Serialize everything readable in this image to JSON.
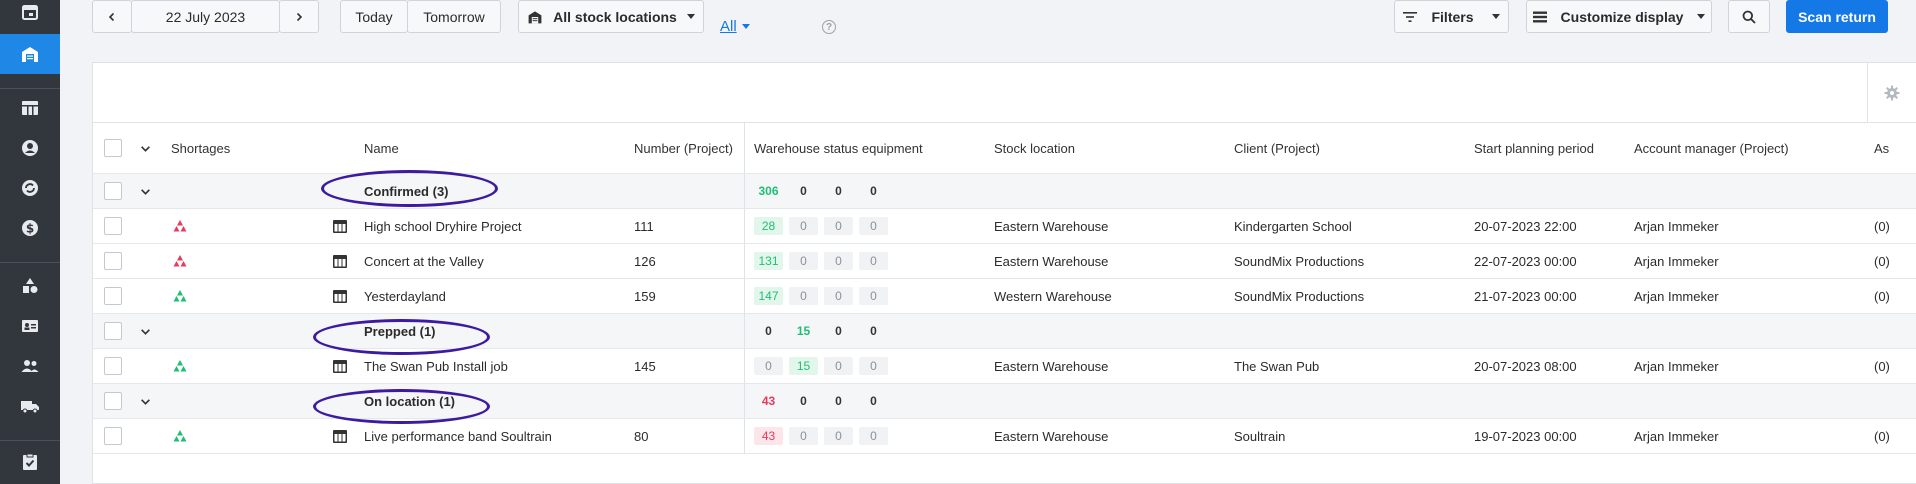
{
  "sidebar": {
    "items": [
      {
        "icon": "calendar-icon"
      },
      {
        "icon": "warehouse-icon",
        "active": true
      },
      {
        "icon": "table-icon"
      },
      {
        "icon": "user-icon"
      },
      {
        "icon": "refresh-icon"
      },
      {
        "icon": "dollar-icon"
      },
      {
        "icon": "shapes-icon"
      },
      {
        "icon": "contact-card-icon"
      },
      {
        "icon": "users-icon"
      },
      {
        "icon": "truck-icon"
      },
      {
        "icon": "clipboard-check-icon"
      }
    ]
  },
  "toolbar": {
    "date": "22 July 2023",
    "today": "Today",
    "tomorrow": "Tomorrow",
    "location": "All stock locations",
    "all_link": "All",
    "filters": "Filters",
    "customize": "Customize display",
    "scan_return": "Scan return"
  },
  "table": {
    "columns": [
      "Shortages",
      "Name",
      "Number (Project)",
      "Warehouse status equipment",
      "Stock location",
      "Client (Project)",
      "Start planning period",
      "Account manager (Project)",
      "As"
    ],
    "groups": [
      {
        "label": "Confirmed (3)",
        "totals": [
          {
            "v": "306",
            "c": "green"
          },
          {
            "v": "0",
            "c": ""
          },
          {
            "v": "0",
            "c": ""
          },
          {
            "v": "0",
            "c": ""
          }
        ],
        "rows": [
          {
            "shortage": "red",
            "name": "High school Dryhire Project",
            "number": "111",
            "status": [
              {
                "v": "28",
                "c": "green"
              },
              {
                "v": "0",
                "c": ""
              },
              {
                "v": "0",
                "c": ""
              },
              {
                "v": "0",
                "c": ""
              }
            ],
            "location": "Eastern Warehouse",
            "client": "Kindergarten School",
            "start": "20-07-2023 22:00",
            "manager": "Arjan Immeker",
            "extra": "(0)"
          },
          {
            "shortage": "red",
            "name": "Concert at the Valley",
            "number": "126",
            "status": [
              {
                "v": "131",
                "c": "green"
              },
              {
                "v": "0",
                "c": ""
              },
              {
                "v": "0",
                "c": ""
              },
              {
                "v": "0",
                "c": ""
              }
            ],
            "location": "Eastern Warehouse",
            "client": "SoundMix Productions",
            "start": "22-07-2023 00:00",
            "manager": "Arjan Immeker",
            "extra": "(0)"
          },
          {
            "shortage": "green",
            "name": "Yesterdayland",
            "number": "159",
            "status": [
              {
                "v": "147",
                "c": "green"
              },
              {
                "v": "0",
                "c": ""
              },
              {
                "v": "0",
                "c": ""
              },
              {
                "v": "0",
                "c": ""
              }
            ],
            "location": "Western Warehouse",
            "client": "SoundMix Productions",
            "start": "21-07-2023 00:00",
            "manager": "Arjan Immeker",
            "extra": "(0)"
          }
        ]
      },
      {
        "label": "Prepped (1)",
        "totals": [
          {
            "v": "0",
            "c": ""
          },
          {
            "v": "15",
            "c": "green"
          },
          {
            "v": "0",
            "c": ""
          },
          {
            "v": "0",
            "c": ""
          }
        ],
        "rows": [
          {
            "shortage": "green",
            "name": "The Swan Pub Install job",
            "number": "145",
            "status": [
              {
                "v": "0",
                "c": ""
              },
              {
                "v": "15",
                "c": "green"
              },
              {
                "v": "0",
                "c": ""
              },
              {
                "v": "0",
                "c": ""
              }
            ],
            "location": "Eastern Warehouse",
            "client": "The Swan Pub",
            "start": "20-07-2023 08:00",
            "manager": "Arjan Immeker",
            "extra": "(0)"
          }
        ]
      },
      {
        "label": "On location (1)",
        "totals": [
          {
            "v": "43",
            "c": "red"
          },
          {
            "v": "0",
            "c": ""
          },
          {
            "v": "0",
            "c": ""
          },
          {
            "v": "0",
            "c": ""
          }
        ],
        "rows": [
          {
            "shortage": "green",
            "name": "Live performance band Soultrain",
            "number": "80",
            "status": [
              {
                "v": "43",
                "c": "red"
              },
              {
                "v": "0",
                "c": ""
              },
              {
                "v": "0",
                "c": ""
              },
              {
                "v": "0",
                "c": ""
              }
            ],
            "location": "Eastern Warehouse",
            "client": "Soultrain",
            "start": "19-07-2023 00:00",
            "manager": "Arjan Immeker",
            "extra": "(0)"
          }
        ]
      }
    ]
  },
  "colors": {
    "accent": "#1479e6",
    "green": "#1fbf73",
    "red": "#e83a5b",
    "ellipse": "#3d1aa0"
  }
}
